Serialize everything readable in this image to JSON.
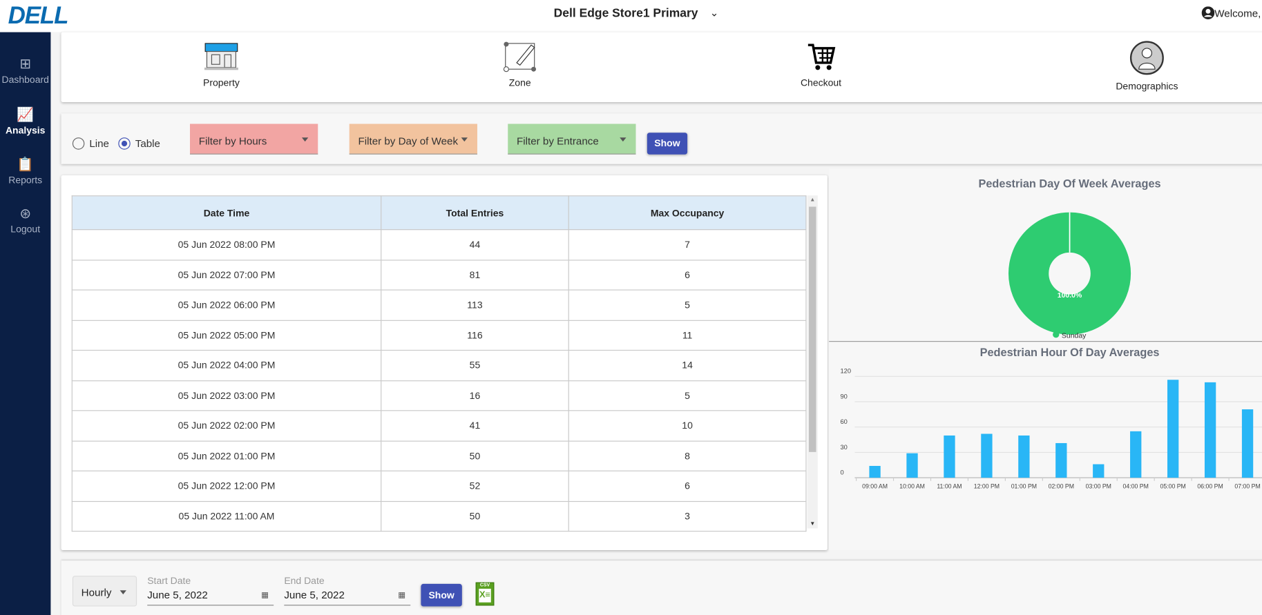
{
  "header": {
    "logo": "DELL",
    "store": "Dell Edge Store1 Primary",
    "welcome": "Welcome,"
  },
  "sidebar": {
    "items": [
      {
        "label": "Dashboard",
        "icon": "dashboard-grid-icon"
      },
      {
        "label": "Analysis",
        "icon": "analysis-chart-icon",
        "active": true
      },
      {
        "label": "Reports",
        "icon": "reports-icon"
      },
      {
        "label": "Logout",
        "icon": "logout-icon"
      }
    ]
  },
  "nav": {
    "items": [
      {
        "label": "Property",
        "icon": "storefront-icon"
      },
      {
        "label": "Zone",
        "icon": "zone-map-icon"
      },
      {
        "label": "Checkout",
        "icon": "shopping-cart-icon"
      },
      {
        "label": "Demographics",
        "icon": "person-profile-icon"
      }
    ]
  },
  "filters": {
    "view_line": "Line",
    "view_table": "Table",
    "selected_view": "Table",
    "hours": "Filter by Hours",
    "day": "Filter by Day of Week",
    "entrance": "Filter by Entrance",
    "show": "Show",
    "colors": {
      "hours": "#f2a5a3",
      "day": "#f2c39e",
      "entrance": "#a8d9a1",
      "button": "#3f51b5"
    }
  },
  "table": {
    "headers": [
      "Date Time",
      "Total Entries",
      "Max Occupancy"
    ],
    "rows": [
      [
        "05 Jun 2022 08:00 PM",
        "44",
        "7"
      ],
      [
        "05 Jun 2022 07:00 PM",
        "81",
        "6"
      ],
      [
        "05 Jun 2022 06:00 PM",
        "113",
        "5"
      ],
      [
        "05 Jun 2022 05:00 PM",
        "116",
        "11"
      ],
      [
        "05 Jun 2022 04:00 PM",
        "55",
        "14"
      ],
      [
        "05 Jun 2022 03:00 PM",
        "16",
        "5"
      ],
      [
        "05 Jun 2022 02:00 PM",
        "41",
        "10"
      ],
      [
        "05 Jun 2022 01:00 PM",
        "50",
        "8"
      ],
      [
        "05 Jun 2022 12:00 PM",
        "52",
        "6"
      ],
      [
        "05 Jun 2022 11:00 AM",
        "50",
        "3"
      ]
    ]
  },
  "chart_data": [
    {
      "type": "pie",
      "title": "Pedestrian Day Of Week Averages",
      "donut": true,
      "slices": [
        {
          "label": "Sunday",
          "value": 100.0,
          "color": "#2ecc71"
        }
      ],
      "data_labels": [
        "100.0%"
      ],
      "legend": "bottom"
    },
    {
      "type": "bar",
      "title": "Pedestrian Hour Of Day Averages",
      "categories": [
        "09:00 AM",
        "10:00 AM",
        "11:00 AM",
        "12:00 PM",
        "01:00 PM",
        "02:00 PM",
        "03:00 PM",
        "04:00 PM",
        "05:00 PM",
        "06:00 PM",
        "07:00 PM"
      ],
      "values": [
        14,
        29,
        50,
        52,
        50,
        41,
        16,
        55,
        116,
        113,
        81
      ],
      "yticks": [
        0,
        30,
        60,
        90,
        120
      ],
      "ylim": [
        0,
        120
      ],
      "grid": true,
      "color": "#29b6f6"
    }
  ],
  "bottom": {
    "interval": "Hourly",
    "start_label": "Start Date",
    "start_value": "June 5, 2022",
    "end_label": "End Date",
    "end_value": "June 5, 2022",
    "show": "Show",
    "csv": "CSV"
  }
}
